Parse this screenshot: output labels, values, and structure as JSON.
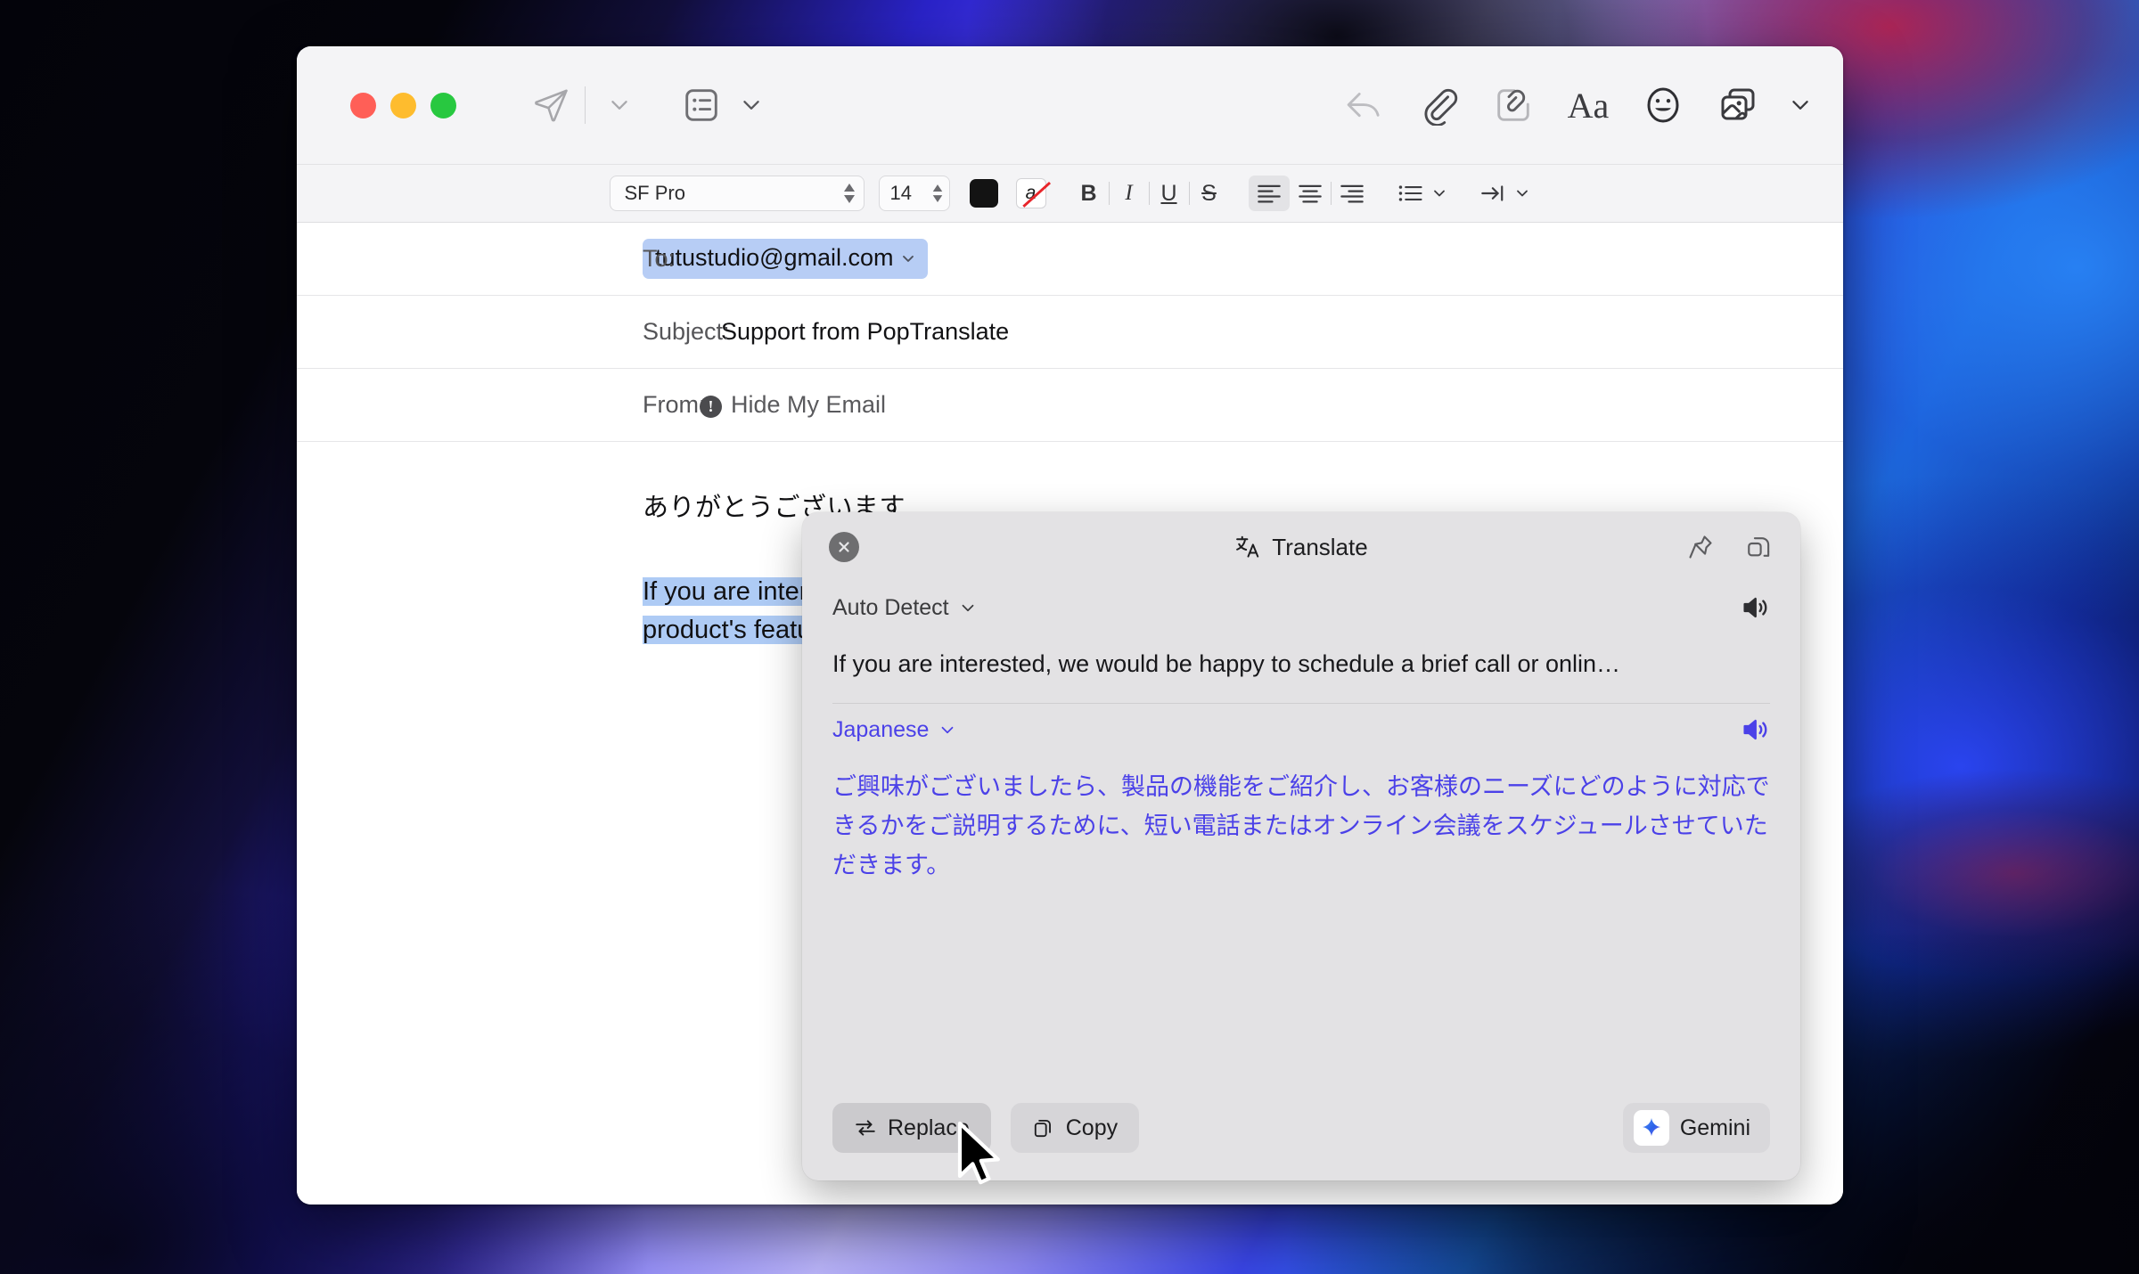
{
  "window": {
    "traffic_lights": [
      "close",
      "minimize",
      "zoom"
    ],
    "toolbar": {
      "send_label": "send-icon",
      "send_menu_label": "chevron-down-icon",
      "stationery_label": "stationery-icon",
      "stationery_menu_label": "chevron-down-icon",
      "reply_label": "reply-icon",
      "attach_label": "attachment-icon",
      "markup_label": "markup-icon",
      "format_label": "Aa",
      "emoji_label": "emoji-icon",
      "photos_label": "photos-icon",
      "photos_menu_label": "chevron-down-icon"
    },
    "format_bar": {
      "font_family": "SF Pro",
      "font_size": "14",
      "text_color": "#131313",
      "highlight_letter": "a",
      "bold_label": "B",
      "italic_label": "I",
      "underline_label": "U",
      "strikethrough_label": "S",
      "align_left": "align-left-icon",
      "align_center": "align-center-icon",
      "align_right": "align-right-icon",
      "list_label": "bulleted-list-icon",
      "indent_label": "indent-icon",
      "active_alignment": "left"
    },
    "fields": {
      "to_label": "To:",
      "to_value": "tutustudio@gmail.com",
      "subject_label": "Subject:",
      "subject_value": "Support from PopTranslate",
      "from_label": "From:",
      "from_value": "Hide My Email"
    },
    "body": {
      "greeting": "ありがとうございます",
      "paragraph_visible": "If you are interested, we would be",
      "paragraph_line2": "product's features and discuss h"
    }
  },
  "translate_popup": {
    "title": "Translate",
    "title_icon": "translate-icon",
    "close_icon": "close-icon",
    "pin_icon": "pin-icon",
    "detach_icon": "detach-window-icon",
    "source": {
      "language": "Auto Detect",
      "text": "If you are interested, we would be happy to schedule a brief call or onlin…",
      "speaker_icon": "speaker-icon"
    },
    "target": {
      "language": "Japanese",
      "text": "ご興味がございましたら、製品の機能をご紹介し、お客様のニーズにどのように対応できるかをご説明するために、短い電話またはオンライン会議をスケジュールさせていただきます。",
      "speaker_icon": "speaker-icon",
      "accent_color": "#4b41e8"
    },
    "actions": {
      "replace_label": "Replace",
      "replace_icon": "swap-arrows-icon",
      "copy_label": "Copy",
      "copy_icon": "copy-icon",
      "gemini_label": "Gemini",
      "gemini_icon": "gemini-sparkle-icon"
    }
  },
  "cursor": {
    "icon": "arrow-cursor"
  }
}
